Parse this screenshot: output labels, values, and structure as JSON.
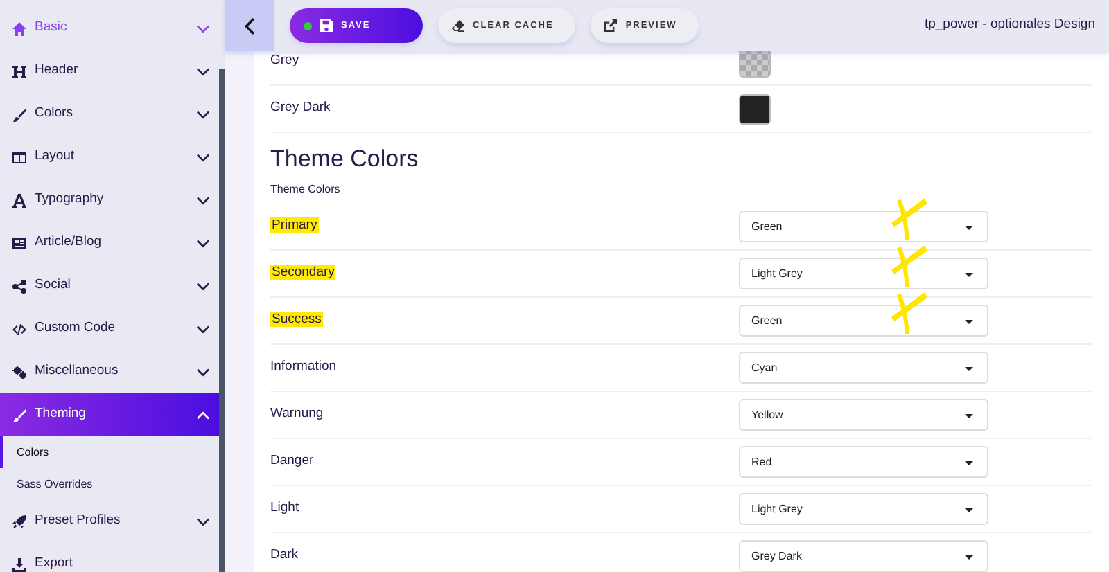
{
  "sidebar": {
    "items": [
      {
        "label": "Basic",
        "selected": true,
        "expanded": false
      },
      {
        "label": "Header",
        "selected": false,
        "expanded": false
      },
      {
        "label": "Colors",
        "selected": false,
        "expanded": false
      },
      {
        "label": "Layout",
        "selected": false,
        "expanded": false
      },
      {
        "label": "Typography",
        "selected": false,
        "expanded": false
      },
      {
        "label": "Article/Blog",
        "selected": false,
        "expanded": false
      },
      {
        "label": "Social",
        "selected": false,
        "expanded": false
      },
      {
        "label": "Custom Code",
        "selected": false,
        "expanded": false
      },
      {
        "label": "Miscellaneous",
        "selected": false,
        "expanded": false
      },
      {
        "label": "Theming",
        "selected": false,
        "expanded": true,
        "children": [
          {
            "label": "Colors",
            "selected": true
          },
          {
            "label": "Sass Overrides",
            "selected": false
          }
        ]
      },
      {
        "label": "Preset Profiles",
        "selected": false,
        "expanded": false
      },
      {
        "label": "Export",
        "selected": false
      }
    ]
  },
  "toolbar": {
    "buttons": [
      {
        "label": "SAVE",
        "kind": "primary",
        "unsaved": true
      },
      {
        "label": "CLEAR CACHE",
        "kind": "light",
        "unsaved": false
      },
      {
        "label": "PREVIEW",
        "kind": "light",
        "unsaved": false
      }
    ],
    "title": "tp_power - optionales Design"
  },
  "swatch_rows": [
    {
      "label": "Grey",
      "swatch": {
        "kind": "transparent"
      }
    },
    {
      "label": "Grey Dark",
      "swatch": {
        "kind": "solid",
        "color": "#222222"
      }
    }
  ],
  "section": {
    "heading": "Theme Colors",
    "subheading": "Theme Colors"
  },
  "color_rows": [
    {
      "label": "Primary",
      "value": "Green",
      "highlighted": true,
      "crossed": true
    },
    {
      "label": "Secondary",
      "value": "Light Grey",
      "highlighted": true,
      "crossed": true
    },
    {
      "label": "Success",
      "value": "Green",
      "highlighted": true,
      "crossed": true
    },
    {
      "label": "Information",
      "value": "Cyan",
      "highlighted": false,
      "crossed": false
    },
    {
      "label": "Warnung",
      "value": "Yellow",
      "highlighted": false,
      "crossed": false
    },
    {
      "label": "Danger",
      "value": "Red",
      "highlighted": false,
      "crossed": false
    },
    {
      "label": "Light",
      "value": "Light Grey",
      "highlighted": false,
      "crossed": false
    },
    {
      "label": "Dark",
      "value": "Grey Dark",
      "highlighted": false,
      "crossed": false
    }
  ]
}
